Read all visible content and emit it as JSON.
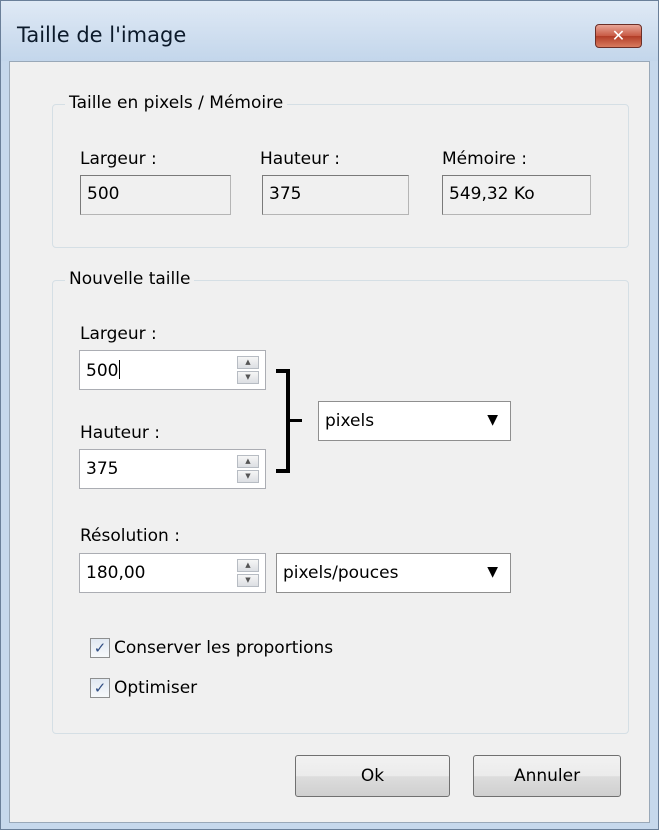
{
  "window": {
    "title": "Taille de l'image",
    "close_glyph": "✕"
  },
  "pixels_group": {
    "title": "Taille en pixels / Mémoire",
    "width_label": "Largeur :",
    "width_value": "500",
    "height_label": "Hauteur :",
    "height_value": "375",
    "memory_label": "Mémoire :",
    "memory_value": "549,32 Ko"
  },
  "new_size_group": {
    "title": "Nouvelle taille",
    "width_label": "Largeur :",
    "width_value": "500",
    "height_label": "Hauteur :",
    "height_value": "375",
    "unit_selected": "pixels",
    "resolution_label": "Résolution :",
    "resolution_value": "180,00",
    "resolution_unit_selected": "pixels/pouces",
    "keep_proportions_label": "Conserver les proportions",
    "keep_proportions_checked": true,
    "optimize_label": "Optimiser",
    "optimize_checked": true
  },
  "buttons": {
    "ok": "Ok",
    "cancel": "Annuler"
  },
  "icons": {
    "spin_up": "▲",
    "spin_down": "▼",
    "dropdown": "▼",
    "check": "✓"
  },
  "colors": {
    "titlebar": "#c6d8ec",
    "close_button": "#c85a44",
    "dialog_bg": "#f0f0f0",
    "checkmark": "#314f84"
  }
}
